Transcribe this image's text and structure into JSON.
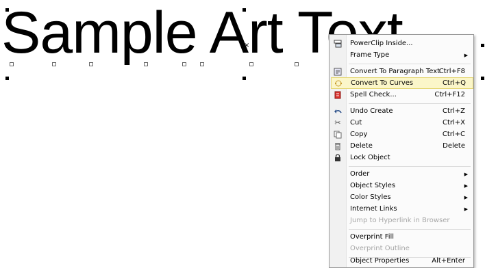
{
  "canvas": {
    "art_text": "Sample Art Text",
    "center_mark": "×"
  },
  "menu": {
    "items": [
      {
        "label": "PowerClip Inside...",
        "shortcut": "",
        "submenu": false,
        "disabled": false,
        "icon": "powerclip-icon"
      },
      {
        "label": "Frame Type",
        "shortcut": "",
        "submenu": true,
        "disabled": false,
        "icon": ""
      },
      {
        "label": "Convert To Paragraph Text",
        "shortcut": "Ctrl+F8",
        "submenu": false,
        "disabled": false,
        "icon": "paragraph-text-icon"
      },
      {
        "label": "Convert To Curves",
        "shortcut": "Ctrl+Q",
        "submenu": false,
        "disabled": false,
        "icon": "curves-icon",
        "highlighted": true
      },
      {
        "label": "Spell Check...",
        "shortcut": "Ctrl+F12",
        "submenu": false,
        "disabled": false,
        "icon": "spell-check-icon"
      },
      {
        "label": "Undo Create",
        "shortcut": "Ctrl+Z",
        "submenu": false,
        "disabled": false,
        "icon": "undo-icon"
      },
      {
        "label": "Cut",
        "shortcut": "Ctrl+X",
        "submenu": false,
        "disabled": false,
        "icon": "scissors-icon"
      },
      {
        "label": "Copy",
        "shortcut": "Ctrl+C",
        "submenu": false,
        "disabled": false,
        "icon": "copy-icon"
      },
      {
        "label": "Delete",
        "shortcut": "Delete",
        "submenu": false,
        "disabled": false,
        "icon": "trash-icon"
      },
      {
        "label": "Lock Object",
        "shortcut": "",
        "submenu": false,
        "disabled": false,
        "icon": "lock-icon"
      },
      {
        "label": "Order",
        "shortcut": "",
        "submenu": true,
        "disabled": false,
        "icon": ""
      },
      {
        "label": "Object Styles",
        "shortcut": "",
        "submenu": true,
        "disabled": false,
        "icon": ""
      },
      {
        "label": "Color Styles",
        "shortcut": "",
        "submenu": true,
        "disabled": false,
        "icon": ""
      },
      {
        "label": "Internet Links",
        "shortcut": "",
        "submenu": true,
        "disabled": false,
        "icon": ""
      },
      {
        "label": "Jump to Hyperlink in Browser",
        "shortcut": "",
        "submenu": false,
        "disabled": true,
        "icon": ""
      },
      {
        "label": "Overprint Fill",
        "shortcut": "",
        "submenu": false,
        "disabled": false,
        "icon": ""
      },
      {
        "label": "Overprint Outline",
        "shortcut": "",
        "submenu": false,
        "disabled": true,
        "icon": ""
      },
      {
        "label": "Object Properties",
        "shortcut": "Alt+Enter",
        "submenu": false,
        "disabled": false,
        "icon": ""
      }
    ],
    "submenu_arrow": "▶",
    "colors": {
      "highlight_bg": "#fbf6c9",
      "highlight_border": "#e5d776",
      "disabled_text": "#a6a6a6"
    }
  }
}
